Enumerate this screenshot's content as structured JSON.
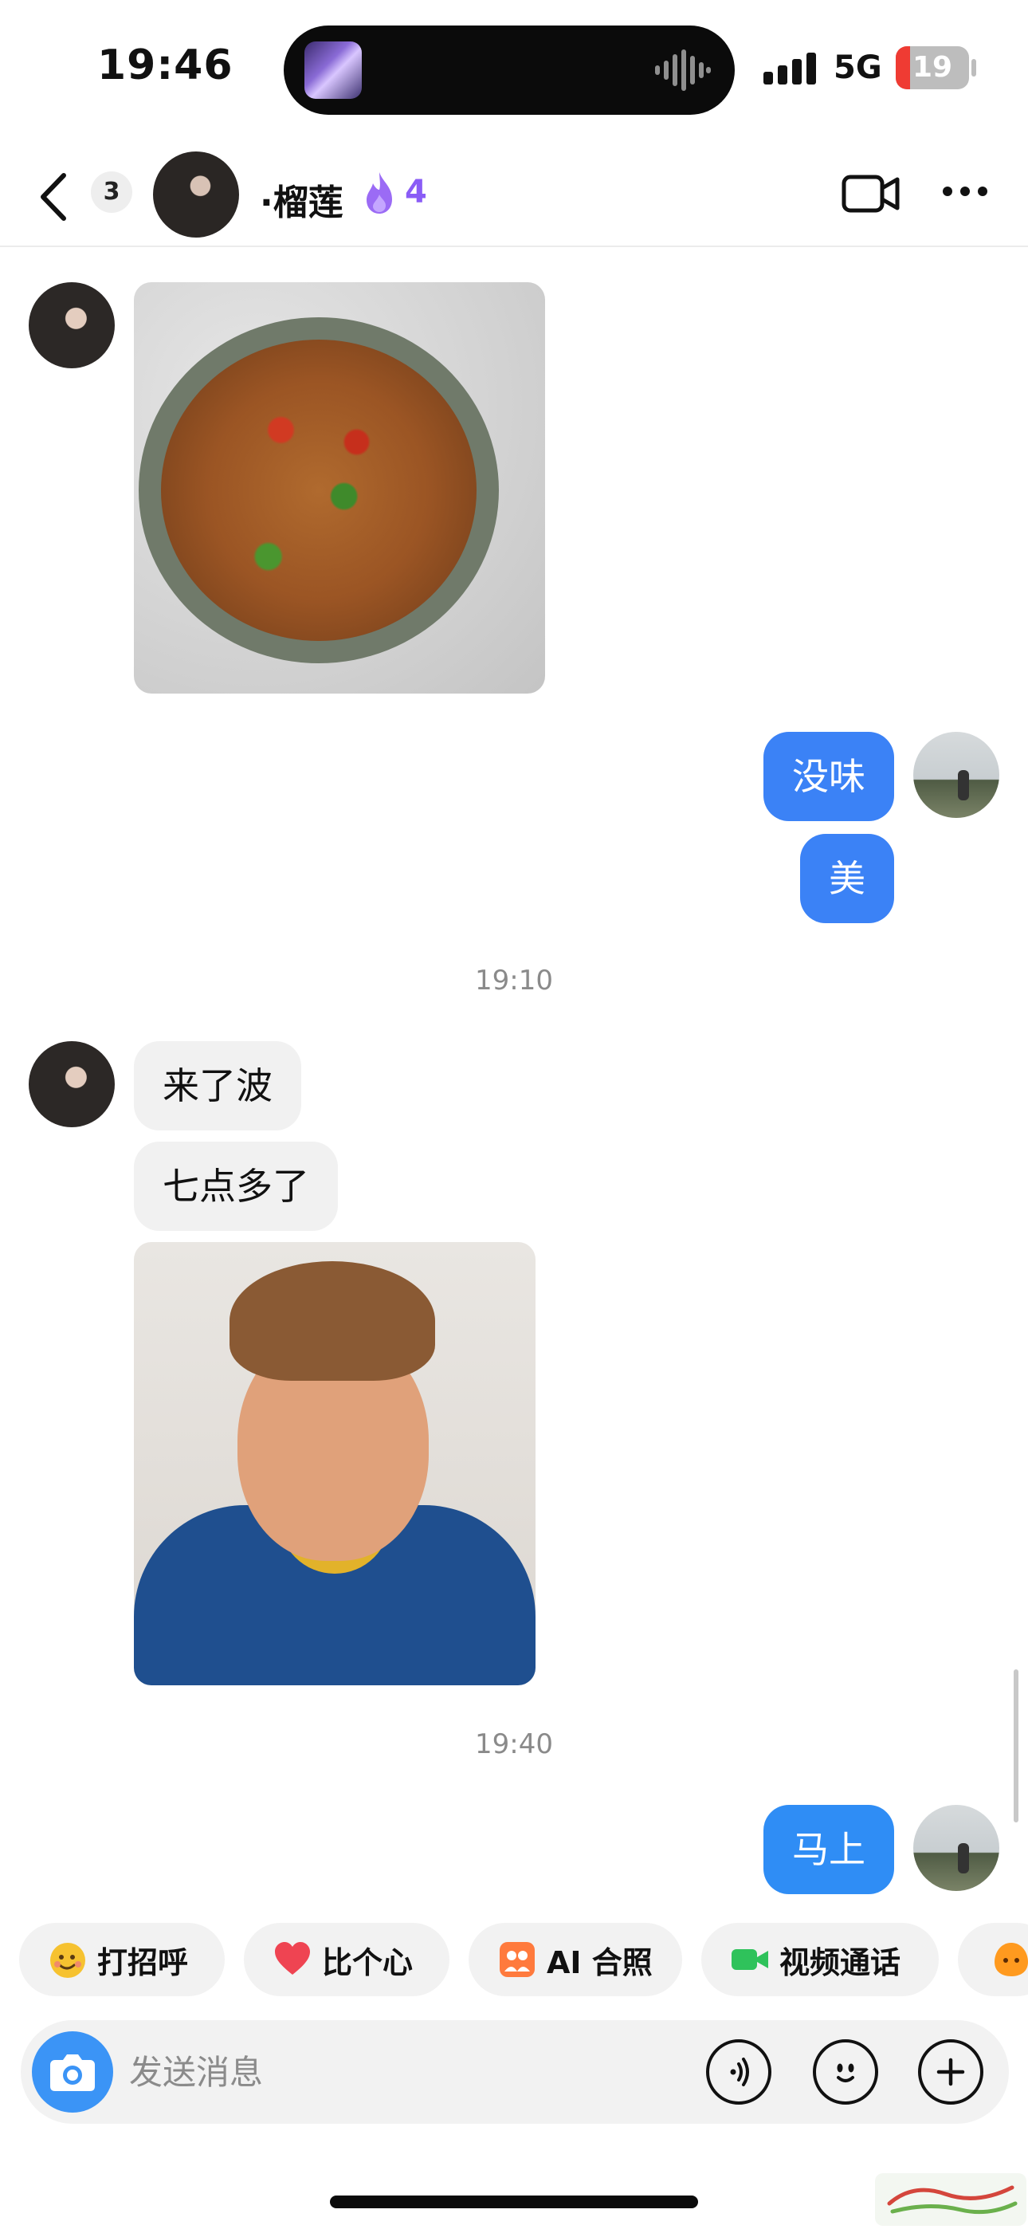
{
  "status_bar": {
    "time": "19:46",
    "network": "5G",
    "battery": "19"
  },
  "header": {
    "unread_count": "3",
    "contact_name": "·榴莲",
    "streak_count": "4"
  },
  "messages": {
    "out_1": "没味",
    "out_2": "美",
    "time_1": "19:10",
    "in_1": "来了波",
    "in_2": "七点多了",
    "time_2": "19:40",
    "out_3": "马上"
  },
  "quick_actions": {
    "greet": "打招呼",
    "heart": "比个心",
    "ai_photo": "AI 合照",
    "video_call": "视频通话"
  },
  "composer": {
    "placeholder": "发送消息"
  },
  "colors": {
    "accent_blue": "#3b82f6",
    "streak_purple": "#8a5cf6",
    "battery_red": "#ef3b33"
  }
}
